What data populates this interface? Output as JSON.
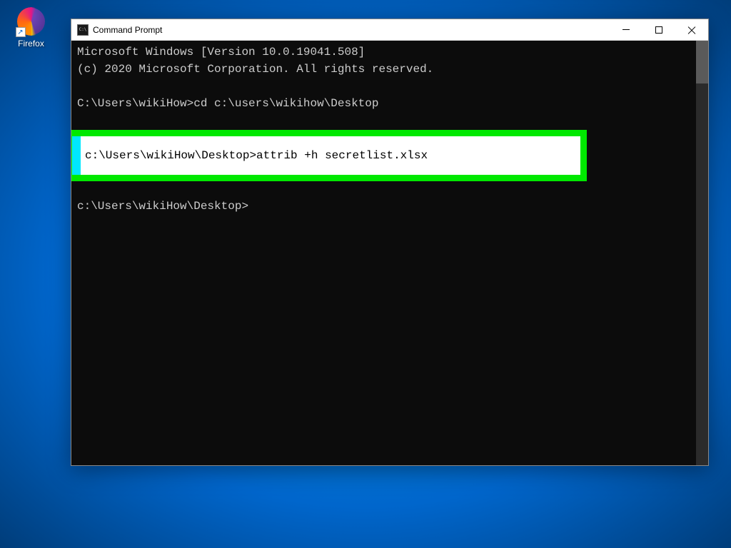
{
  "desktop": {
    "firefox_label": "Firefox"
  },
  "window": {
    "title": "Command Prompt"
  },
  "terminal": {
    "line1": "Microsoft Windows [Version 10.0.19041.508]",
    "line2": "(c) 2020 Microsoft Corporation. All rights reserved.",
    "line3_prompt": "C:\\Users\\wikiHow>",
    "line3_cmd": "cd c:\\users\\wikihow\\Desktop",
    "highlighted_prompt": "c:\\Users\\wikiHow\\Desktop>",
    "highlighted_cmd": "attrib +h secretlist.xlsx",
    "line5_prompt": "c:\\Users\\wikiHow\\Desktop>"
  }
}
